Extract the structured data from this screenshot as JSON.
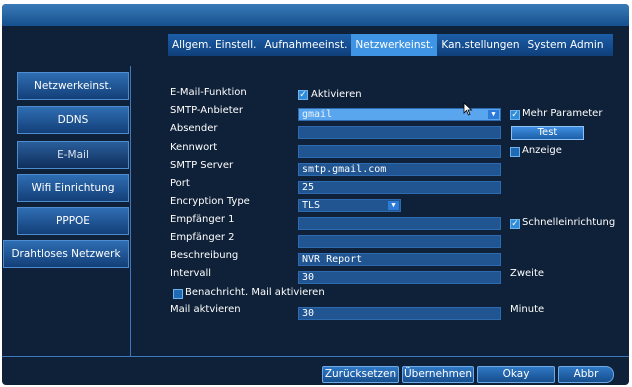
{
  "tabs": [
    {
      "label": "Allgem. Einstell."
    },
    {
      "label": "Aufnahmeeinst."
    },
    {
      "label": "Netzwerkeinst.",
      "active": true
    },
    {
      "label": "Kan.stellungen"
    },
    {
      "label": "System Admin"
    }
  ],
  "sidebar": {
    "items": [
      {
        "label": "Netzwerkeinst."
      },
      {
        "label": "DDNS"
      },
      {
        "label": "E-Mail",
        "active": true
      },
      {
        "label": "Wifi Einrichtung"
      },
      {
        "label": "PPPOE"
      },
      {
        "label": "Drahtloses Netzwerk"
      }
    ]
  },
  "form": {
    "email_function_label": "E-Mail-Funktion",
    "activate_label": "Aktivieren",
    "smtp_provider_label": "SMTP-Anbieter",
    "smtp_provider_value": "gmail",
    "more_params_label": "Mehr Parameter",
    "sender_label": "Absender",
    "sender_value": "",
    "test_button": "Test",
    "password_label": "Kennwort",
    "password_value": "",
    "show_label": "Anzeige",
    "smtp_server_label": "SMTP Server",
    "smtp_server_value": "smtp.gmail.com",
    "port_label": "Port",
    "port_value": "25",
    "encryption_label": "Encryption Type",
    "encryption_value": "TLS",
    "recipient1_label": "Empfänger 1",
    "recipient1_value": "",
    "quick_setup_label": "Schnelleinrichtung",
    "recipient2_label": "Empfänger 2",
    "recipient2_value": "",
    "description_label": "Beschreibung",
    "description_value": "NVR Report",
    "interval_label": "Intervall",
    "interval_value": "30",
    "interval_unit": "Zweite",
    "notify_mail_label": "Benachricht. Mail aktivieren",
    "mail_activate_label": "Mail aktvieren",
    "mail_activate_value": "30",
    "mail_activate_unit": "Minute"
  },
  "buttons": {
    "reset": "Zurücksetzen",
    "apply": "Übernehmen",
    "ok": "Okay",
    "cancel": "Abbr"
  },
  "checkboxes": {
    "activate": true,
    "more_params": true,
    "show": false,
    "quick_setup": true,
    "notify_mail": false
  },
  "colors": {
    "panel_bg": "#0f2138",
    "tab_active": "#3f95e3",
    "field_bg": "#205592",
    "field_selected": "#5aa6ee"
  }
}
